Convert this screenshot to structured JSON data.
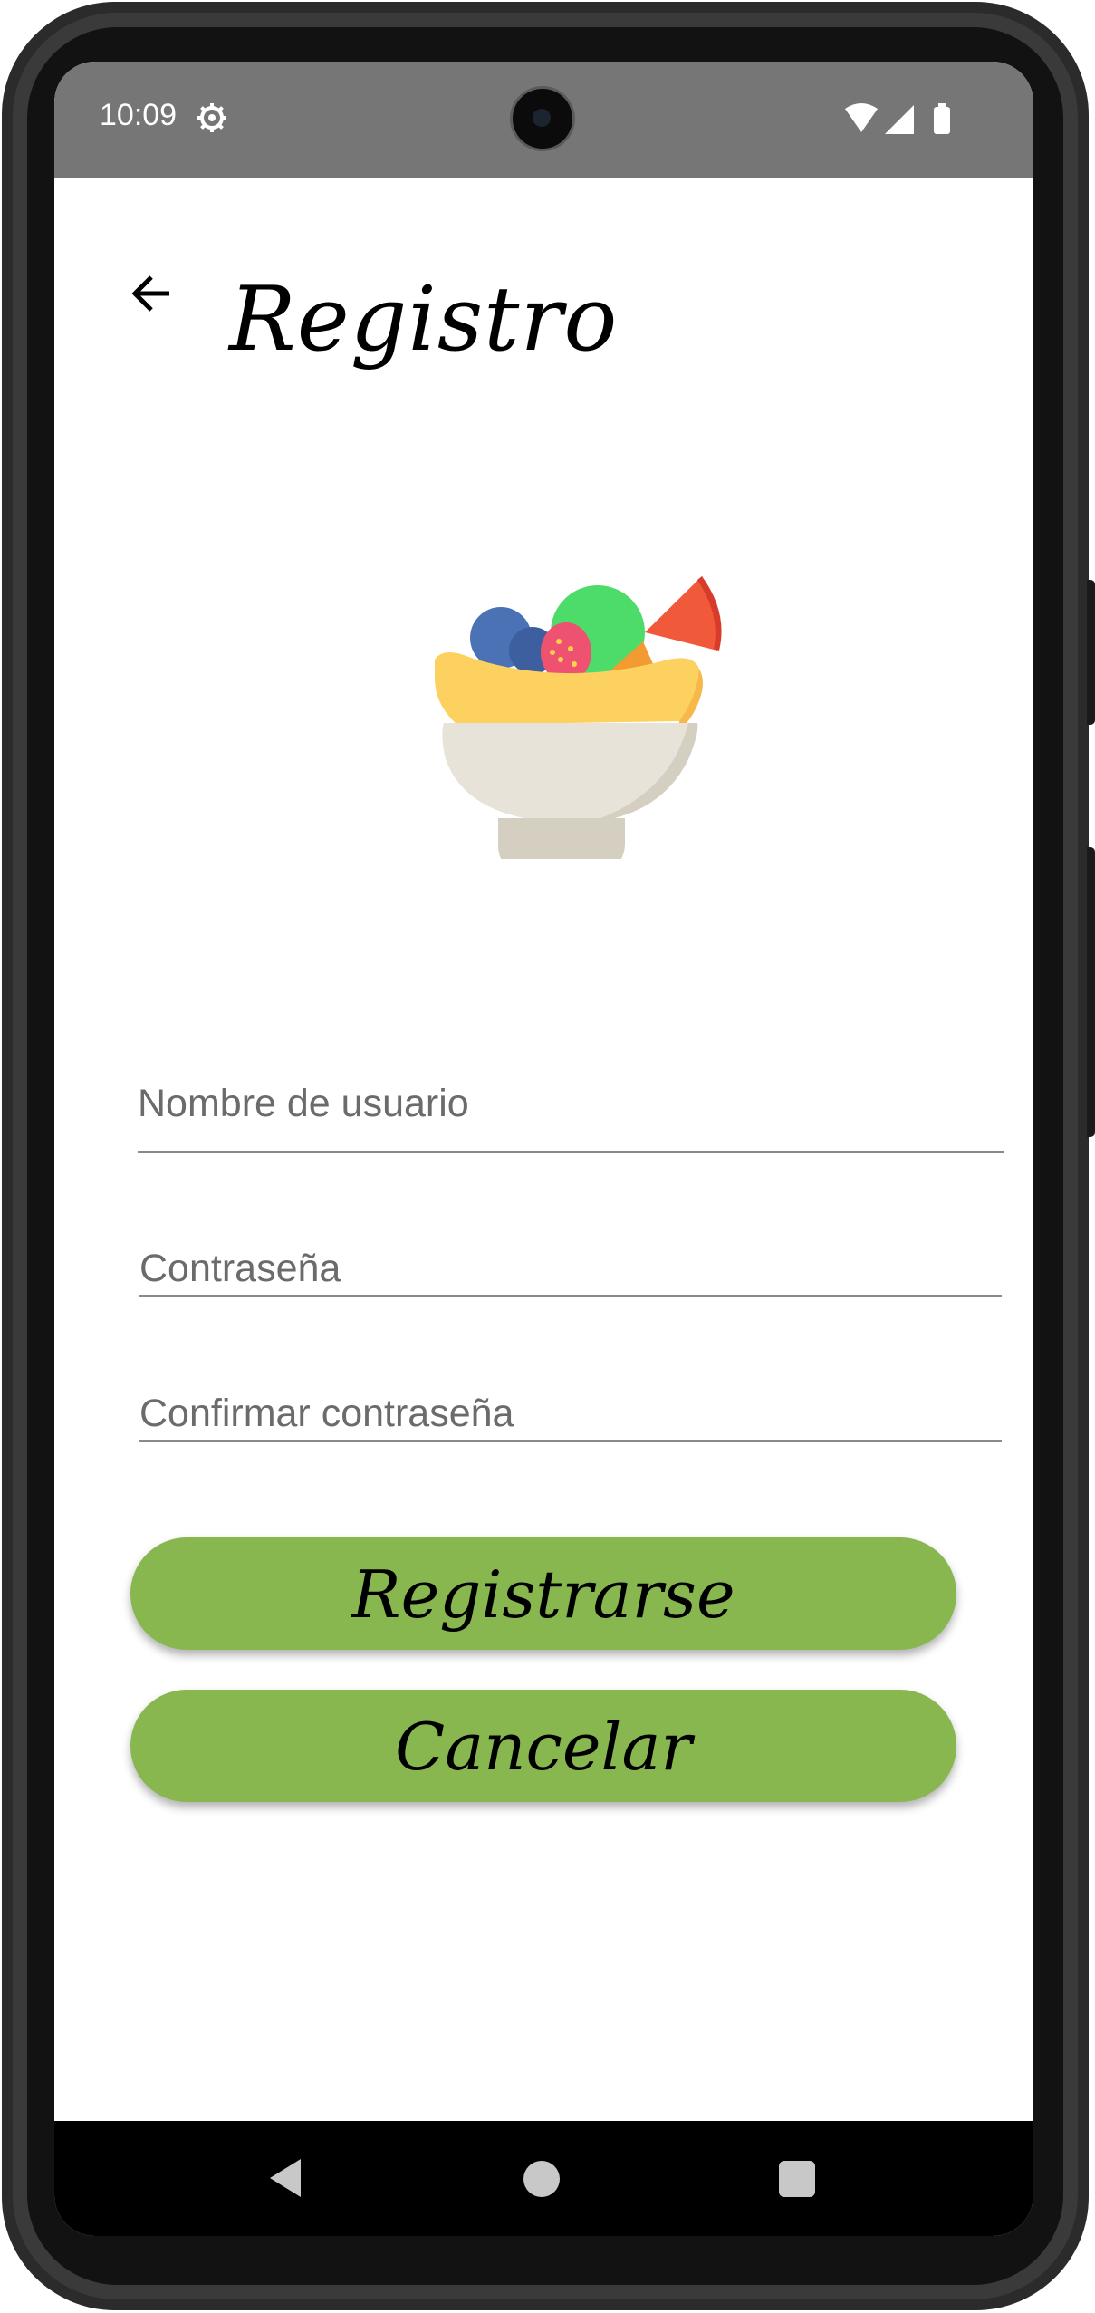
{
  "status_bar": {
    "time": "10:09",
    "icons": [
      "gear-icon",
      "wifi-icon",
      "signal-icon",
      "battery-icon"
    ],
    "background": "#767676"
  },
  "app_bar": {
    "title": "Registro",
    "back_icon": "arrow-left-icon"
  },
  "logo": {
    "icon": "fruit-bowl-icon"
  },
  "form": {
    "username_placeholder": "Nombre de usuario",
    "password_placeholder": "Contraseña",
    "confirm_password_placeholder": "Confirmar contraseña",
    "register_label": "Registrarse",
    "cancel_label": "Cancelar"
  },
  "colors": {
    "button": "#88b74f",
    "underline": "#8a8a8a"
  },
  "nav_bar": {
    "icons": [
      "nav-back-icon",
      "nav-home-icon",
      "nav-recents-icon"
    ]
  }
}
